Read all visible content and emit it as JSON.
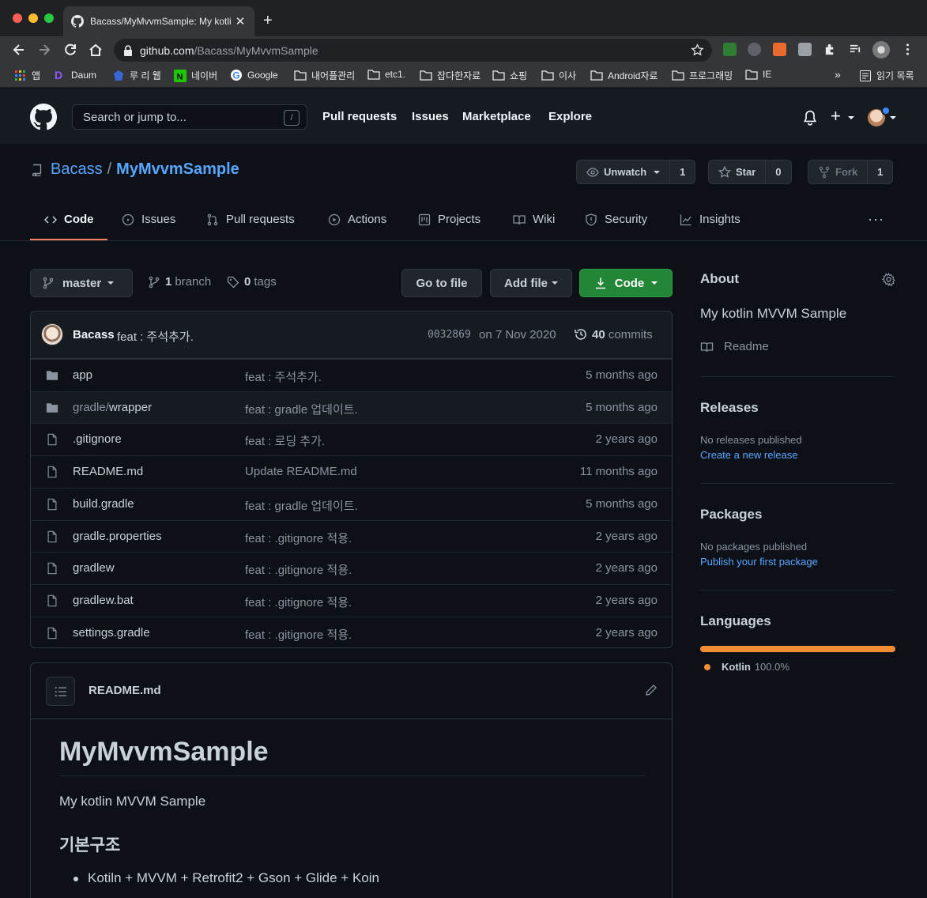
{
  "browser": {
    "tab_title": "Bacass/MyMvvmSample: My kotlin MVVM Sample",
    "url_host": "github.com",
    "url_path": "/Bacass/MyMvvmSample",
    "bookmarks": [
      "앱",
      "Daum",
      "루 리 웹",
      "네이버",
      "Google",
      "내어플관리",
      "etc1.",
      "잡다한자료",
      "쇼핑",
      "이사",
      "Android자료",
      "프로그래밍",
      "IE"
    ],
    "overflow": "»",
    "reading_list": "읽기 목록"
  },
  "header": {
    "search_placeholder": "Search or jump to...",
    "search_shortcut": "/",
    "nav": [
      "Pull requests",
      "Issues",
      "Marketplace",
      "Explore"
    ]
  },
  "repo": {
    "owner": "Bacass",
    "separator": "/",
    "name": "MyMvvmSample",
    "watch_label": "Unwatch",
    "watch_count": "1",
    "star_label": "Star",
    "star_count": "0",
    "fork_label": "Fork",
    "fork_count": "1"
  },
  "tabs": [
    {
      "label": "Code",
      "icon": "code-icon"
    },
    {
      "label": "Issues",
      "icon": "issue-icon"
    },
    {
      "label": "Pull requests",
      "icon": "pull-request-icon"
    },
    {
      "label": "Actions",
      "icon": "play-icon"
    },
    {
      "label": "Projects",
      "icon": "project-icon"
    },
    {
      "label": "Wiki",
      "icon": "book-icon"
    },
    {
      "label": "Security",
      "icon": "shield-icon"
    },
    {
      "label": "Insights",
      "icon": "graph-icon"
    }
  ],
  "toolbar": {
    "branch": "master",
    "branch_count": "1",
    "branch_label": "branch",
    "tag_count": "0",
    "tag_label": "tags",
    "go_to_file": "Go to file",
    "add_file": "Add file",
    "code": "Code"
  },
  "commit": {
    "author": "Bacass",
    "message": "feat : 주석추가.",
    "sha": "0032869",
    "date": "on 7 Nov 2020",
    "count": "40",
    "count_label": "commits"
  },
  "files": [
    {
      "type": "dir",
      "name": "app",
      "name_dim": "",
      "message": "feat : 주석추가.",
      "age": "5 months ago"
    },
    {
      "type": "dir",
      "name": "wrapper",
      "name_dim": "gradle/",
      "message": "feat : gradle 업데이트.",
      "age": "5 months ago"
    },
    {
      "type": "file",
      "name": ".gitignore",
      "name_dim": "",
      "message": "feat : 로딩 추가.",
      "age": "2 years ago"
    },
    {
      "type": "file",
      "name": "README.md",
      "name_dim": "",
      "message": "Update README.md",
      "age": "11 months ago"
    },
    {
      "type": "file",
      "name": "build.gradle",
      "name_dim": "",
      "message": "feat : gradle 업데이트.",
      "age": "5 months ago"
    },
    {
      "type": "file",
      "name": "gradle.properties",
      "name_dim": "",
      "message": "feat : .gitignore 적용.",
      "age": "2 years ago"
    },
    {
      "type": "file",
      "name": "gradlew",
      "name_dim": "",
      "message": "feat : .gitignore 적용.",
      "age": "2 years ago"
    },
    {
      "type": "file",
      "name": "gradlew.bat",
      "name_dim": "",
      "message": "feat : .gitignore 적용.",
      "age": "2 years ago"
    },
    {
      "type": "file",
      "name": "settings.gradle",
      "name_dim": "",
      "message": "feat : .gitignore 적용.",
      "age": "2 years ago"
    }
  ],
  "readme": {
    "filename": "README.md",
    "h1": "MyMvvmSample",
    "paragraph": "My kotlin MVVM Sample",
    "h2": "기본구조",
    "item": "Kotiln + MVVM + Retrofit2 + Gson + Glide + Koin"
  },
  "sidebar": {
    "about_title": "About",
    "description": "My kotlin MVVM Sample",
    "readme_link": "Readme",
    "releases_title": "Releases",
    "releases_empty": "No releases published",
    "releases_link": "Create a new release",
    "packages_title": "Packages",
    "packages_empty": "No packages published",
    "packages_link": "Publish your first package",
    "languages_title": "Languages",
    "language": "Kotlin",
    "language_pct": "100.0%",
    "language_fraction": 1.0,
    "language_color": "#F18E33"
  },
  "colors": {
    "accent_link": "#58a6ff",
    "tab_underline": "#f78166",
    "code_button": "#238636",
    "notification_dot": "#388bfd"
  }
}
